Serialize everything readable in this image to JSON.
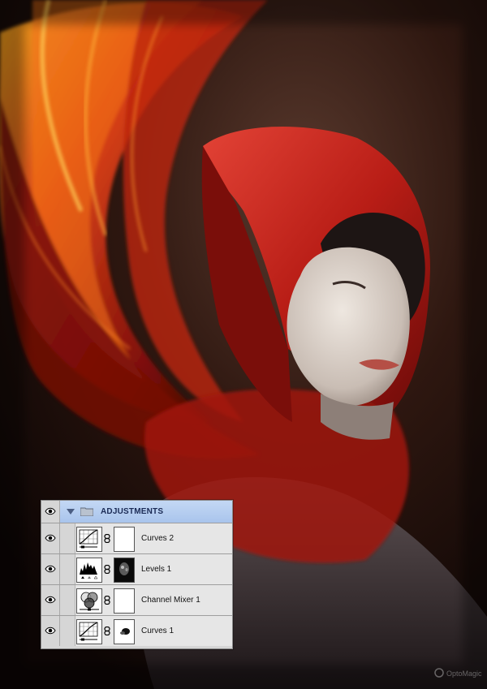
{
  "layers_panel": {
    "group_name": "ADJUSTMENTS",
    "layers": [
      {
        "name": "Curves 2",
        "icon": "curves-icon",
        "mask": "white"
      },
      {
        "name": "Levels 1",
        "icon": "levels-icon",
        "mask": "dark-face-mask"
      },
      {
        "name": "Channel Mixer 1",
        "icon": "channel-mixer-icon",
        "mask": "white"
      },
      {
        "name": "Curves 1",
        "icon": "curves-icon",
        "mask": "white-with-dark-spot"
      }
    ]
  },
  "watermark": "OptoMagic"
}
